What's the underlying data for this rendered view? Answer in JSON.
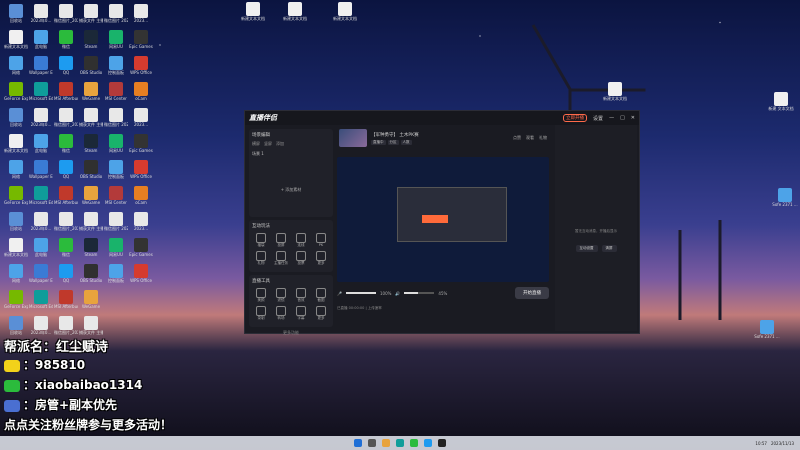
{
  "desktop": {
    "left_icons": [
      {
        "label": "回收站",
        "color": "#5a8fd6"
      },
      {
        "label": "2023年0...",
        "color": "#e8e8e8"
      },
      {
        "label": "微信图片_2023...",
        "color": "#e8e8e8"
      },
      {
        "label": "捕获文件 主播...",
        "color": "#e8e8e8"
      },
      {
        "label": "微信图片 2023...",
        "color": "#e8e8e8"
      },
      {
        "label": "2023...",
        "color": "#e8e8e8"
      },
      {
        "label": "新建文本文档",
        "color": "#f0f0f0"
      },
      {
        "label": "此电脑",
        "color": "#4da3e8"
      },
      {
        "label": "微信",
        "color": "#2bbb3c"
      },
      {
        "label": "Steam",
        "color": "#1b2838"
      },
      {
        "label": "网易UU",
        "color": "#19b36b"
      },
      {
        "label": "Epic Games",
        "color": "#333333"
      },
      {
        "label": "网络",
        "color": "#4da3e8"
      },
      {
        "label": "Wallpaper Engine",
        "color": "#3a7bd5"
      },
      {
        "label": "QQ",
        "color": "#1d9bf0"
      },
      {
        "label": "OBS Studio",
        "color": "#303030"
      },
      {
        "label": "控制面板",
        "color": "#4da3e8"
      },
      {
        "label": "WPS Office",
        "color": "#d63b2f"
      },
      {
        "label": "GeForce Experience",
        "color": "#76b900"
      },
      {
        "label": "Microsoft Edge",
        "color": "#0f9d9a"
      },
      {
        "label": "MSI Afterburner",
        "color": "#c0392b"
      },
      {
        "label": "WeGame",
        "color": "#e8a33d"
      },
      {
        "label": "MSI Center",
        "color": "#b33a3a"
      },
      {
        "label": "oCam",
        "color": "#e67e22"
      }
    ],
    "right_icons": [
      {
        "label": "新建文本文档",
        "color": "#f0f0f0"
      },
      {
        "label": "新建文本文档",
        "color": "#f0f0f0"
      },
      {
        "label": "新建文本文档",
        "color": "#f0f0f0"
      },
      {
        "label": "新建文本文档",
        "color": "#f0f0f0"
      },
      {
        "label": "新建 文本文档",
        "color": "#f0f0f0"
      },
      {
        "label": "Sofe 2371 ...",
        "color": "#4da3e8"
      },
      {
        "label": "Sofe 2371 ...",
        "color": "#4da3e8"
      }
    ]
  },
  "app": {
    "logo": "直播伴侣",
    "title_buttons": [
      "立即开播",
      "设置"
    ],
    "left": {
      "scene_title": "场景编辑",
      "scene_tabs": [
        "横屏",
        "竖屏",
        "添加"
      ],
      "scene_item": "场景 1",
      "add_source": "+ 添加素材",
      "interact_title": "互动玩法",
      "interact_tools": [
        "福袋",
        "投屏",
        "连线",
        "PK",
        "礼物",
        "主播任务",
        "投票",
        "更多"
      ],
      "tools_title": "直播工具",
      "live_tools": [
        "美颜",
        "滤镜",
        "音效",
        "截图",
        "录制",
        "转场",
        "字幕",
        "更多"
      ],
      "more": "更多功能"
    },
    "center": {
      "room_title": "【军种勇守】 土木PK赛",
      "tags": [
        "直播中",
        "分区",
        "人数"
      ],
      "stats": [
        "点赞",
        "观看",
        "礼物"
      ],
      "volume_mic": "100%",
      "volume_speaker": "45%",
      "go_live": "开始直播",
      "footer": "已直播 00:00:00 | 上传速率"
    },
    "right": {
      "empty_msg": "暂无互动消息，开播后显示",
      "buttons": [
        "互动设置",
        "清屏"
      ]
    }
  },
  "overlay": {
    "line1": "帮派名：红尘赋诗",
    "line2": "：985810",
    "line3": "：xiaobaibao1314",
    "line4": "：房管+副本优先",
    "line5": "点点关注粉丝牌参与更多活动！"
  },
  "taskbar": {
    "time": "10:57",
    "date": "2023/11/13"
  }
}
